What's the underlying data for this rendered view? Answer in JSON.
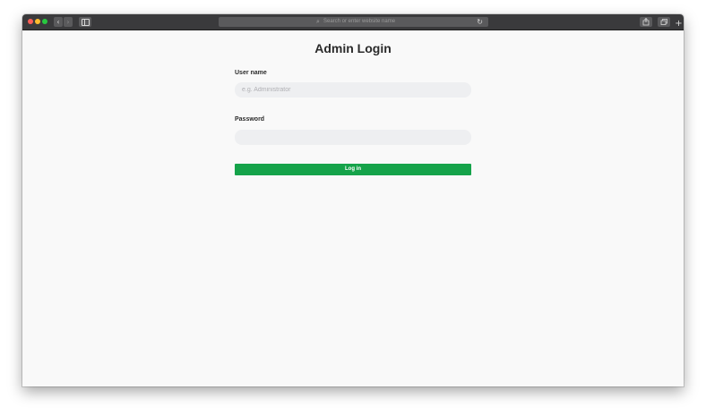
{
  "browser": {
    "address_placeholder": "Search or enter website name",
    "icons": {
      "back": "chevron-left-icon",
      "forward": "chevron-right-icon",
      "sidebar": "sidebar-icon",
      "search": "search-icon",
      "reload": "reload-icon",
      "share": "share-icon",
      "tabs": "tabs-icon",
      "new_tab": "plus-icon"
    },
    "traffic_colors": {
      "close": "#ff5f57",
      "minimize": "#febc2e",
      "maximize": "#28c840"
    }
  },
  "page": {
    "title": "Admin Login",
    "username": {
      "label": "User name",
      "placeholder": "e.g. Administrator",
      "value": ""
    },
    "password": {
      "label": "Password",
      "placeholder": "",
      "value": ""
    },
    "login_button_label": "Log in",
    "accent_color": "#15a34a"
  }
}
